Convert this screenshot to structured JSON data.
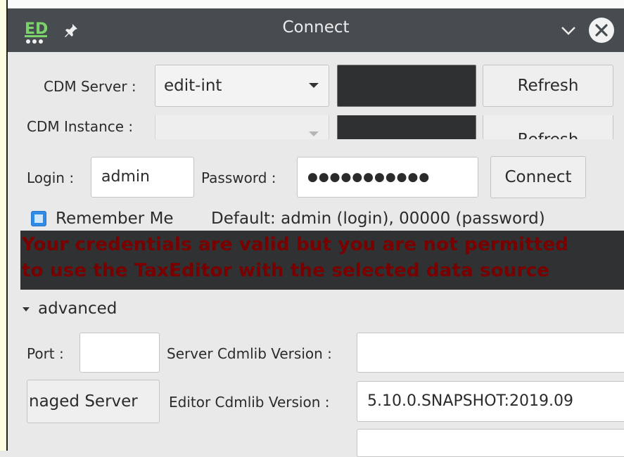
{
  "window": {
    "title": "Connect",
    "app_logo_text": "ED"
  },
  "server": {
    "label": "CDM Server :",
    "selected": "edit-int",
    "refresh_label": "Refresh"
  },
  "instance": {
    "label": "CDM Instance :",
    "selected": "",
    "refresh_label": "Refresh"
  },
  "login": {
    "label": "Login :",
    "value": "admin",
    "password_label": "Password :",
    "password_value": "●●●●●●●●●●●",
    "connect_label": "Connect"
  },
  "remember": {
    "label": "Remember Me",
    "checked": true,
    "default_hint": "Default: admin (login), 00000 (password)"
  },
  "error": {
    "line1": "Your credentials are valid but you are not permitted",
    "line2": "to use the TaxEditor with the selected data source",
    "color": "#7a0000"
  },
  "advanced": {
    "label": "advanced",
    "port_label": "Port :",
    "port_value": "",
    "server_version_label": "Server Cdmlib Version :",
    "server_version_value": "",
    "managed_server_label": "naged Server",
    "editor_version_label": "Editor Cdmlib Version :",
    "editor_version_value": "5.10.0.SNAPSHOT:2019.09"
  },
  "colors": {
    "titlebar": "#474c51",
    "checkbox": "#2f8be8",
    "dark_panel": "#2e3032"
  }
}
